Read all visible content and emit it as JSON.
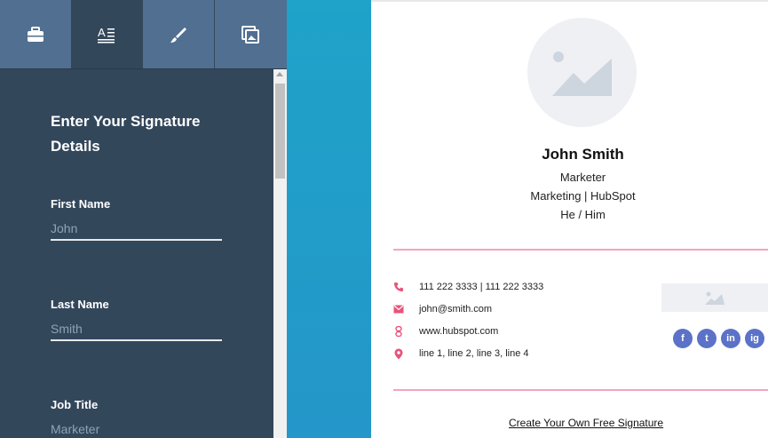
{
  "tabs": [
    {
      "icon": "briefcase-icon",
      "active": false
    },
    {
      "icon": "text-format-icon",
      "active": true
    },
    {
      "icon": "brush-icon",
      "active": false
    },
    {
      "icon": "image-copy-icon",
      "active": false
    }
  ],
  "form": {
    "title": "Enter Your Signature Details",
    "fields": [
      {
        "label": "First Name",
        "placeholder": "John"
      },
      {
        "label": "Last Name",
        "placeholder": "Smith"
      },
      {
        "label": "Job Title",
        "placeholder": "Marketer"
      }
    ]
  },
  "signature": {
    "name": "John Smith",
    "job_title": "Marketer",
    "department_company": "Marketing | HubSpot",
    "pronouns": "He / Him",
    "phone": "111 222 3333 | 111 222 3333",
    "email": "john@smith.com",
    "website": "www.hubspot.com",
    "address": "line 1, line 2, line 3, line 4",
    "socials": [
      "f",
      "t",
      "in",
      "ig"
    ],
    "cta": "Create Your Own Free Signature"
  },
  "colors": {
    "panel": "#33475b",
    "tab": "#516f90",
    "accent_pink": "#e8537a",
    "divider": "#f2a5bf",
    "social": "#5b72c8",
    "blue_strip": "#1fa3c9"
  }
}
